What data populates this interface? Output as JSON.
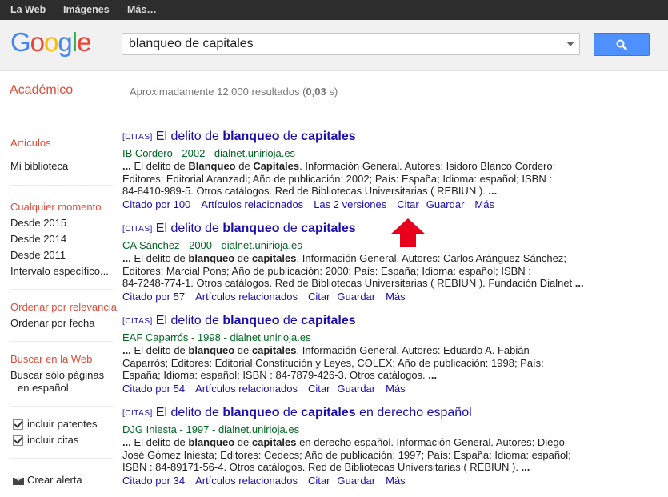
{
  "topbar": {
    "items": [
      "La Web",
      "Imágenes",
      "Más…"
    ]
  },
  "logo": {
    "letters": [
      "G",
      "o",
      "o",
      "g",
      "l",
      "e"
    ],
    "colors": [
      "#4285f4",
      "#ea4335",
      "#fbbc05",
      "#4285f4",
      "#34a853",
      "#ea4335"
    ]
  },
  "search": {
    "value": "blanqueo de capitales"
  },
  "subheader": {
    "title": "Académico",
    "result_prefix": "Aproximadamente 12.000 resultados (",
    "result_time": "0,03",
    "result_suffix": " s)"
  },
  "sidebar": {
    "articulos": "Artículos",
    "mi_biblioteca": "Mi biblioteca",
    "cualquier_momento": "Cualquier momento",
    "desde_2015": "Desde 2015",
    "desde_2014": "Desde 2014",
    "desde_2011": "Desde 2011",
    "intervalo": "Intervalo específico...",
    "ordenar_relevancia": "Ordenar por relevancia",
    "ordenar_fecha": "Ordenar por fecha",
    "buscar_web": "Buscar en la Web",
    "buscar_paginas_1": "Buscar sólo páginas",
    "buscar_paginas_2": "en español",
    "incluir_patentes": "incluir patentes",
    "incluir_citas": "incluir citas",
    "crear_alerta": "Crear alerta"
  },
  "results": [
    {
      "tag": "[CITAS]",
      "title": [
        "El delito de ",
        "blanqueo",
        " de ",
        "capitales",
        ""
      ],
      "source": "IB Cordero - 2002 - dialnet.unirioja.es",
      "snippet": [
        [
          "... ",
          "El delito de ",
          "Blanqueo",
          " de ",
          "Capitales",
          ". Información General. Autores: Isidoro Blanco Cordero;"
        ],
        [
          "Editores: Editorial Aranzadi; Año de publicación: 2002; País: España; Idioma: español; ISBN :"
        ],
        [
          "84-8410-989-5. Otros catálogos. Red de Bibliotecas Universitarias ( REBIUN ). ",
          "..."
        ]
      ],
      "links": [
        "Citado por 100",
        "Artículos relacionados",
        "Las 2 versiones",
        "Citar",
        "Guardar",
        "Más"
      ]
    },
    {
      "tag": "[CITAS]",
      "title": [
        "El delito de ",
        "blanqueo",
        " de ",
        "capitales",
        ""
      ],
      "source": "CA Sánchez - 2000 - dialnet.unirioja.es",
      "snippet": [
        [
          "... ",
          "El delito de ",
          "blanqueo",
          " de ",
          "capitales",
          ". Información General. Autores: Carlos Aránguez Sánchez;"
        ],
        [
          "Editores: Marcial Pons; Año de publicación: 2000; País: España; Idioma: español; ISBN :"
        ],
        [
          "84-7248-774-1. Otros catálogos. Red de Bibliotecas Universitarias ( REBIUN ). Fundación Dialnet ",
          "..."
        ]
      ],
      "links": [
        "Citado por 57",
        "Artículos relacionados",
        "Citar",
        "Guardar",
        "Más"
      ]
    },
    {
      "tag": "[CITAS]",
      "title": [
        "El delito de ",
        "blanqueo",
        " de ",
        "capitales",
        ""
      ],
      "source": "EAF Caparrós - 1998 - dialnet.unirioja.es",
      "snippet": [
        [
          "... ",
          "El delito de ",
          "blanqueo",
          " de ",
          "capitales",
          ". Información General. Autores: Eduardo A. Fabián"
        ],
        [
          "Caparrós; Editores: Editorial Constitución y Leyes, COLEX; Año de publicación: 1998; País:"
        ],
        [
          "España; Idioma: español; ISBN : 84-7879-426-3. Otros catálogos. ",
          "..."
        ]
      ],
      "links": [
        "Citado por 54",
        "Artículos relacionados",
        "Citar",
        "Guardar",
        "Más"
      ]
    },
    {
      "tag": "[CITAS]",
      "title": [
        "El delito de ",
        "blanqueo",
        " de ",
        "capitales",
        " en derecho español"
      ],
      "source": "DJG Iniesta - 1997 - dialnet.unirioja.es",
      "snippet": [
        [
          "... ",
          "El delito de ",
          "blanqueo",
          " de ",
          "capitales",
          " en derecho español. Información General. Autores: Diego"
        ],
        [
          "José Gómez Iniesta; Editores: Cedecs; Año de publicación: 1997; País: España; Idioma: español;"
        ],
        [
          "ISBN : 84-89171-56-4. Otros catálogos. Red de Bibliotecas Universitarias ( REBIUN ). ",
          "..."
        ]
      ],
      "links": [
        "Citado por 34",
        "Artículos relacionados",
        "Citar",
        "Guardar",
        "Más"
      ]
    }
  ],
  "annotation": {
    "arrow_color": "#e8001c"
  }
}
